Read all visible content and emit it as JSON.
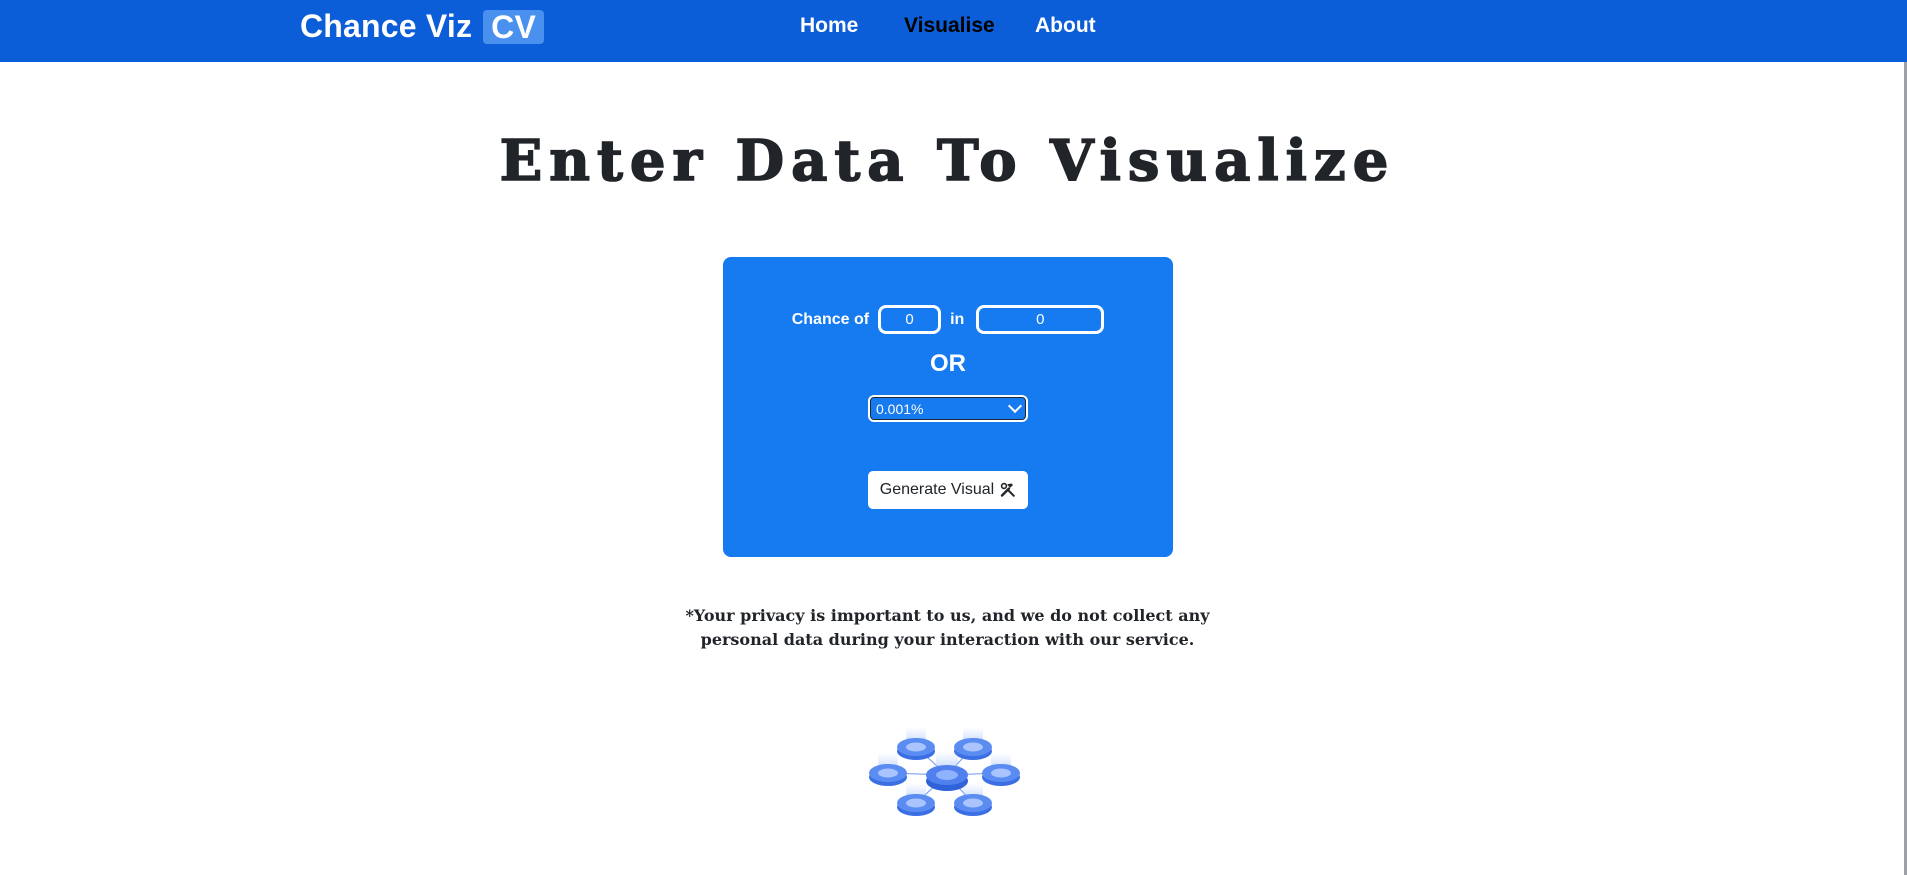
{
  "header": {
    "brand": "Chance Viz",
    "brand_badge": "CV",
    "nav": [
      {
        "label": "Home",
        "active": false
      },
      {
        "label": "Visualise",
        "active": true
      },
      {
        "label": "About",
        "active": false
      }
    ]
  },
  "main": {
    "title": "Enter Data To Visualize",
    "form": {
      "chance_of_label": "Chance of",
      "chance_of_value": "0",
      "in_label": "in",
      "in_value": "0",
      "or_label": "OR",
      "percent_selected": "0.001%",
      "generate_label": "Generate Visual"
    },
    "privacy_note": "*Your privacy is important to us, and we do not collect any personal data during your interaction with our service."
  },
  "icons": {
    "generate": "hammer-wrench-icon",
    "dropdown": "chevron-down-icon",
    "illustration": "connected-nodes-illustration"
  },
  "colors": {
    "navbar": "#0b5ed7",
    "card": "#167af0",
    "text_dark": "#212529"
  }
}
